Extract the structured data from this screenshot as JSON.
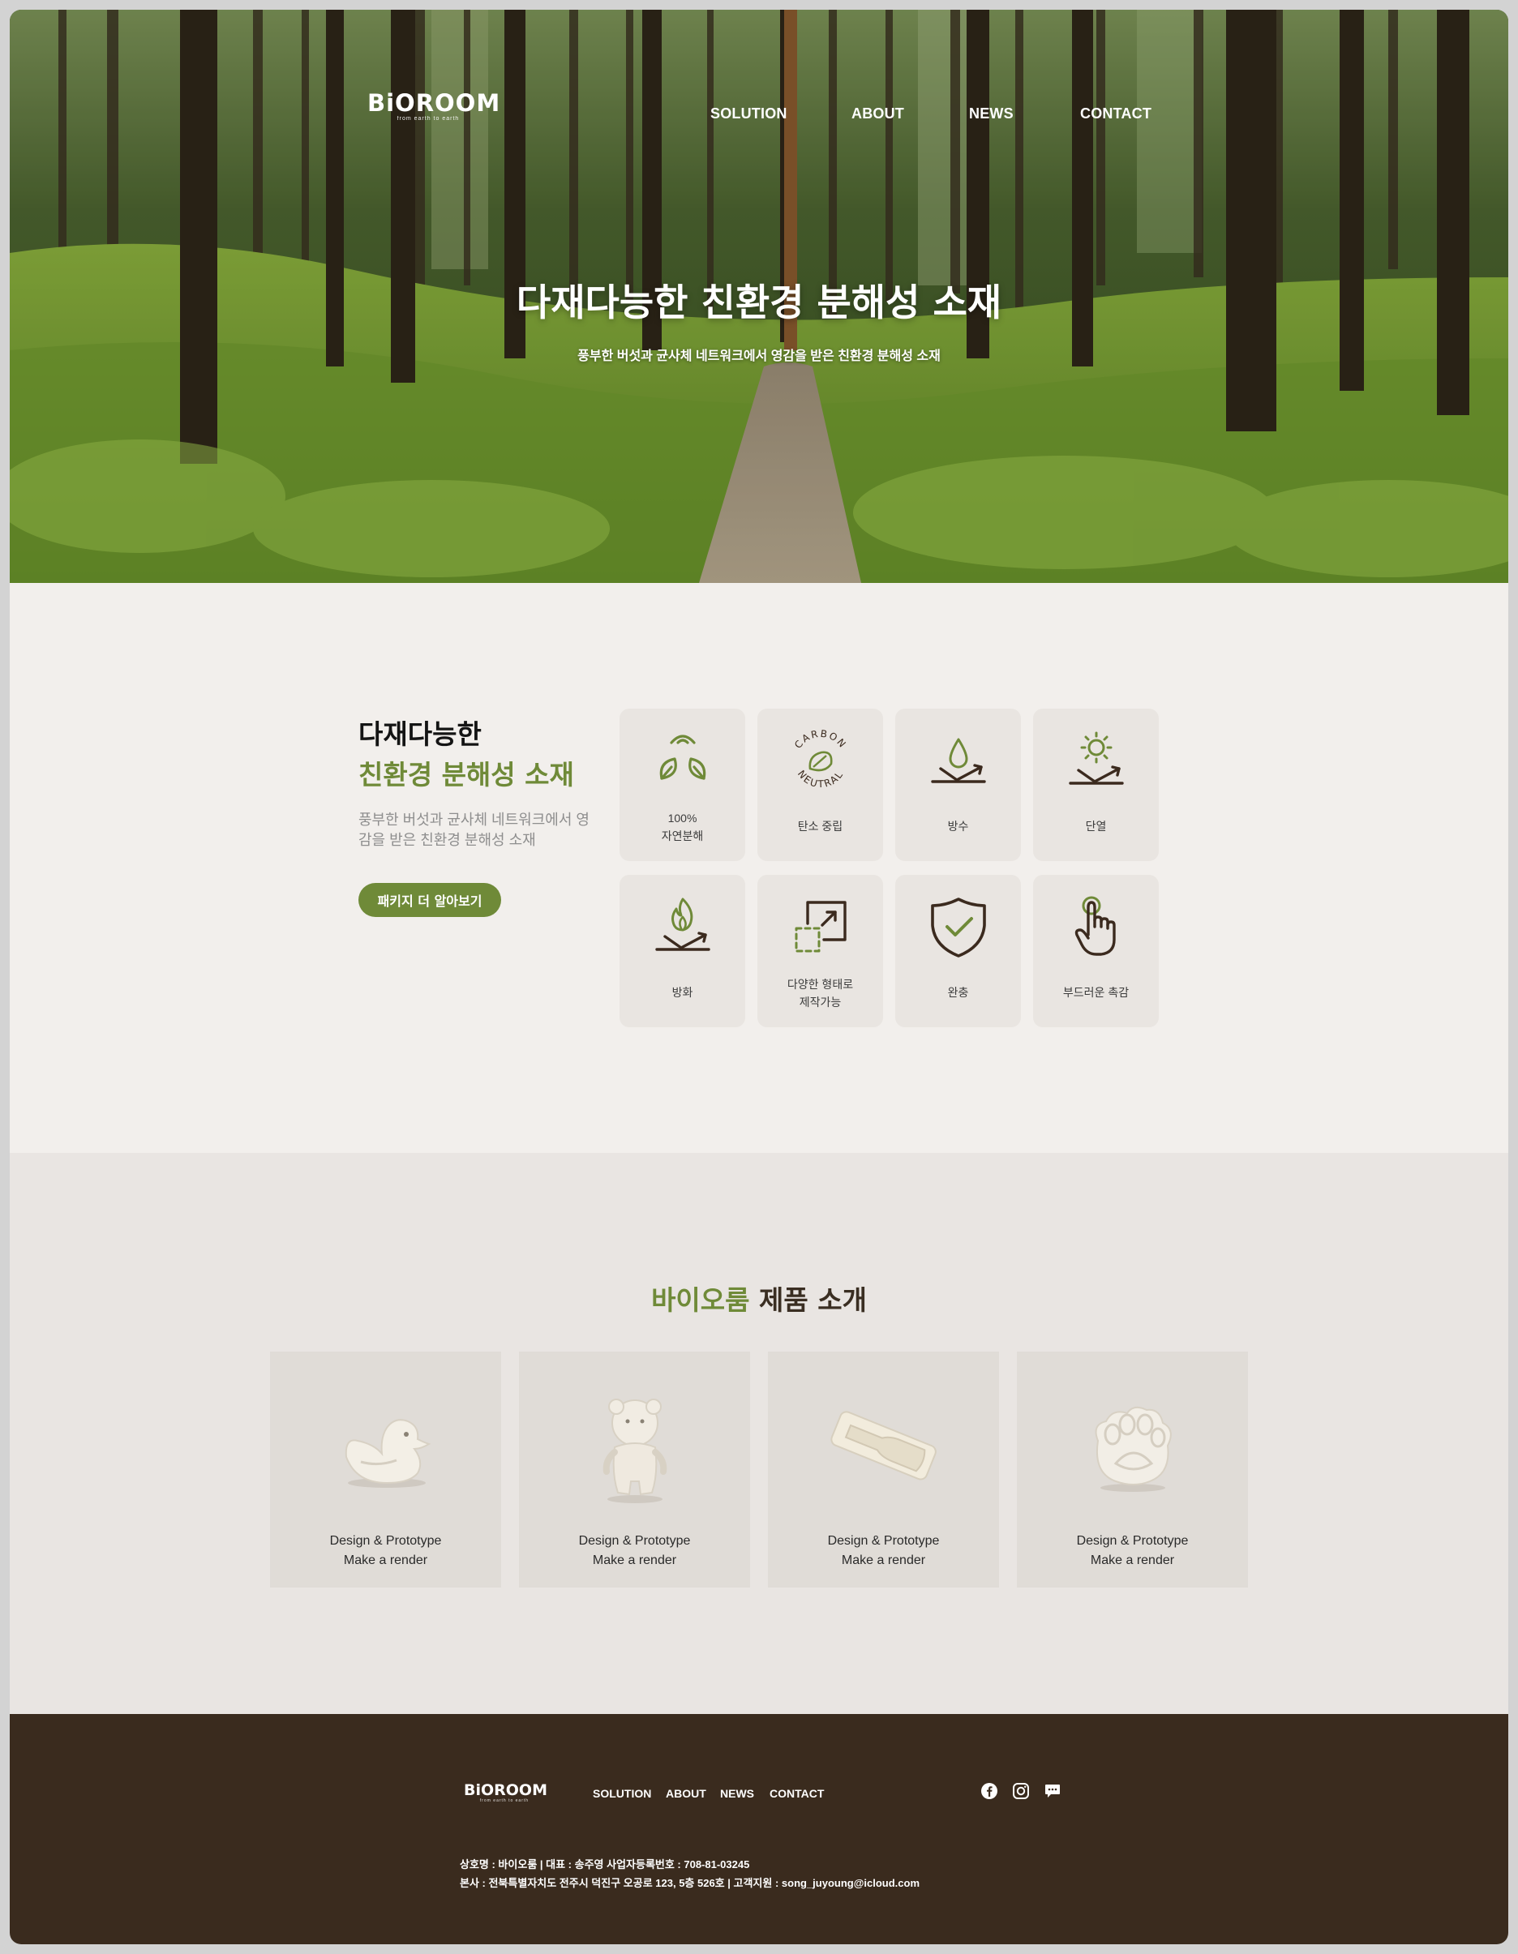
{
  "header": {
    "logo": {
      "word": "BiOROOM",
      "tagline": "from earth to earth"
    },
    "nav": [
      "SOLUTION",
      "ABOUT",
      "NEWS",
      "CONTACT"
    ]
  },
  "hero": {
    "title": "다재다능한 친환경 분해성 소재",
    "subtitle": "풍부한 버섯과 균사체 네트워크에서 영감을 받은 친환경 분해성 소재"
  },
  "features": {
    "title_line1": "다재다능한",
    "title_line2": "친환경 분해성 소재",
    "description": "풍부한 버섯과 균사체 네트워크에서 영감을 받은 친환경 분해성 소재",
    "button_label": "패키지 더 알아보기",
    "items": [
      {
        "icon": "leaves-recycle-icon",
        "label": "100%\n자연분해"
      },
      {
        "icon": "carbon-neutral-icon",
        "label": "탄소 중립",
        "badge_top": "CARBON",
        "badge_bottom": "NEUTRAL"
      },
      {
        "icon": "water-drop-icon",
        "label": "방수"
      },
      {
        "icon": "sun-icon",
        "label": "단열"
      },
      {
        "icon": "flame-icon",
        "label": "방화"
      },
      {
        "icon": "resize-shape-icon",
        "label": "다양한 형태로\n제작가능"
      },
      {
        "icon": "shield-check-icon",
        "label": "완충"
      },
      {
        "icon": "touch-hand-icon",
        "label": "부드러운 촉감"
      }
    ],
    "colors": {
      "accent": "#6f8a38",
      "icon_dark": "#3b2a1e"
    }
  },
  "products": {
    "title_green": "바이오룸",
    "title_rest": " 제품 소개",
    "items": [
      {
        "image": "duck-figure",
        "line1": "Design & Prototype",
        "line2": "Make a render"
      },
      {
        "image": "bear-figure",
        "line1": "Design & Prototype",
        "line2": "Make a render"
      },
      {
        "image": "bottle-tray",
        "line1": "Design & Prototype",
        "line2": "Make a render"
      },
      {
        "image": "paw-figure",
        "line1": "Design & Prototype",
        "line2": "Make a render"
      }
    ]
  },
  "footer": {
    "logo": {
      "word": "BiOROOM",
      "tagline": "from earth to earth"
    },
    "nav": [
      "SOLUTION",
      "ABOUT",
      "NEWS",
      "CONTACT"
    ],
    "social": [
      "facebook-icon",
      "instagram-icon",
      "chat-icon"
    ],
    "info_line1": "상호명 : 바이오룸 | 대표 : 송주영 사업자등록번호 : 708-81-03245",
    "info_line2": "본사 : 전북특별자치도 전주시 덕진구 오공로 123, 5층 526호 | 고객지원 : song_juyoung@icloud.com",
    "background": "#3a2b1e"
  }
}
